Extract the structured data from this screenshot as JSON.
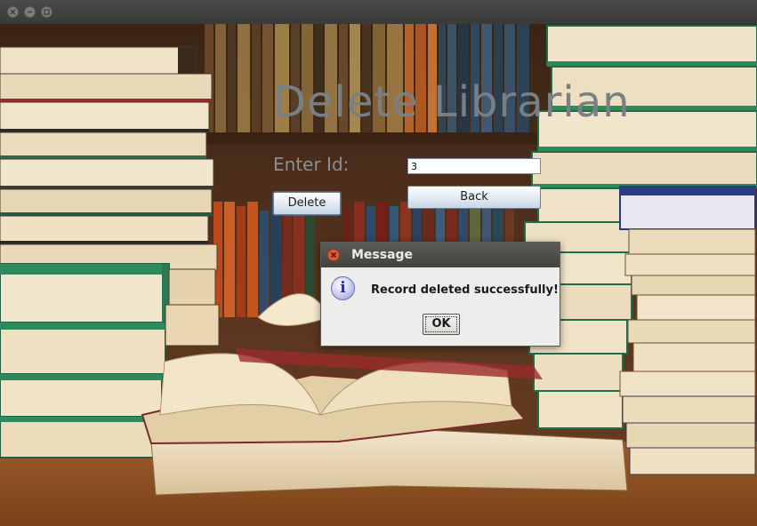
{
  "window": {
    "controls": [
      "close-icon",
      "minimize-icon",
      "maximize-icon"
    ]
  },
  "form": {
    "heading": "Delete Librarian",
    "id_label": "Enter Id:",
    "id_value": "3",
    "delete_label": "Delete",
    "back_label": "Back"
  },
  "dialog": {
    "title": "Message",
    "message": "Record deleted successfully!",
    "ok_label": "OK",
    "icon": "info-icon",
    "icon_glyph": "i"
  },
  "colors": {
    "heading": "#7a7f84",
    "dialog_title_bg": "#4f4e4b",
    "close_button": "#e2582f",
    "button_gradient_end": "#c9d6e6"
  }
}
